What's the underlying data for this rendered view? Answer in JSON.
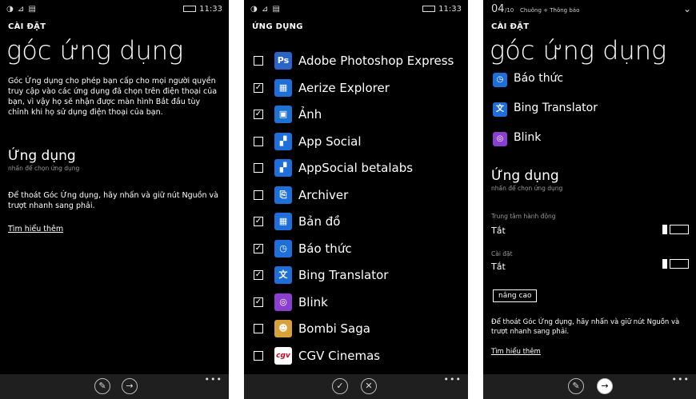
{
  "p1": {
    "status": {
      "left": "◑ ⊿ ▤",
      "time": "11:33"
    },
    "section": "CÀI ĐẶT",
    "title": "góc ứng dụng",
    "desc": "Góc Ứng dụng cho phép bạn cấp cho mọi người quyền truy cập vào các ứng dụng đã chọn trên điện thoại của bạn, vì vậy họ sẽ nhận được màn hình Bắt đầu tùy chỉnh khi họ sử dụng điện thoại của bạn.",
    "apps_heading": "Ứng dụng",
    "apps_note": "nhấn để chọn ứng dụng",
    "exit_text": "Để thoát Góc Ứng dụng, hãy nhấn và giữ nút Nguồn và trượt nhanh sang phải.",
    "learn_more": "Tìm hiểu thêm",
    "appbar": {
      "pin_glyph": "✎",
      "go_glyph": "→",
      "dots": "•••"
    }
  },
  "p2": {
    "status": {
      "left": "◑ ⊿ ▤",
      "time": "11:33"
    },
    "section": "ỨNG DỤNG",
    "apps": [
      {
        "name": "Adobe Photoshop Express",
        "checked": false,
        "icon": "Ps",
        "color": "#2a64c9"
      },
      {
        "name": "Aerize Explorer",
        "checked": true,
        "icon": "▦",
        "color": "#1e6fd9"
      },
      {
        "name": "Ảnh",
        "checked": true,
        "icon": "▣",
        "color": "#1e73d2"
      },
      {
        "name": "App Social",
        "checked": false,
        "icon": "▞",
        "color": "#1e6fd9"
      },
      {
        "name": "AppSocial betalabs",
        "checked": false,
        "icon": "▞",
        "color": "#1e6fd9"
      },
      {
        "name": "Archiver",
        "checked": false,
        "icon": "⎘",
        "color": "#1e6fd9"
      },
      {
        "name": "Bản đồ",
        "checked": true,
        "icon": "▦",
        "color": "#1e6fd9"
      },
      {
        "name": "Báo thức",
        "checked": true,
        "icon": "◷",
        "color": "#1e6fd9"
      },
      {
        "name": "Bing Translator",
        "checked": true,
        "icon": "文",
        "color": "#1e6fd9"
      },
      {
        "name": "Blink",
        "checked": true,
        "icon": "◎",
        "color": "#8b3fd1"
      },
      {
        "name": "Bombi Saga",
        "checked": false,
        "icon": "☻",
        "color": "#d8a13a"
      },
      {
        "name": "CGV Cinemas",
        "checked": false,
        "icon": "cgv",
        "color": "#ffffff"
      }
    ],
    "check_glyph": "✓",
    "appbar": {
      "ok_glyph": "✓",
      "cancel_glyph": "✕",
      "dots": "•••"
    }
  },
  "p3": {
    "status": {
      "big": "04",
      "small": "/10",
      "label": "Chuông + Thông báo",
      "chevron": "⌄"
    },
    "section": "CÀI ĐẶT",
    "title": "góc ứng dụng",
    "apps": [
      {
        "name": "Báo thức",
        "icon": "◷",
        "color": "#1e6fd9"
      },
      {
        "name": "Bing Translator",
        "icon": "文",
        "color": "#1e6fd9"
      },
      {
        "name": "Blink",
        "icon": "◎",
        "color": "#8b3fd1"
      }
    ],
    "apps_heading": "Ứng dụng",
    "apps_note": "nhấn để chọn ứng dụng",
    "action_center_label": "Trung tâm hành động",
    "action_center_value": "Tắt",
    "settings_label": "Cài đặt",
    "settings_value": "Tắt",
    "advanced_button": "nâng cao",
    "exit_text": "Để thoát Góc Ứng dụng, hãy nhấn và giữ nút Nguồn và trượt nhanh sang phải.",
    "learn_more": "Tìm hiểu thêm",
    "appbar": {
      "pin_glyph": "✎",
      "go_glyph": "→",
      "dots": "•••"
    }
  }
}
